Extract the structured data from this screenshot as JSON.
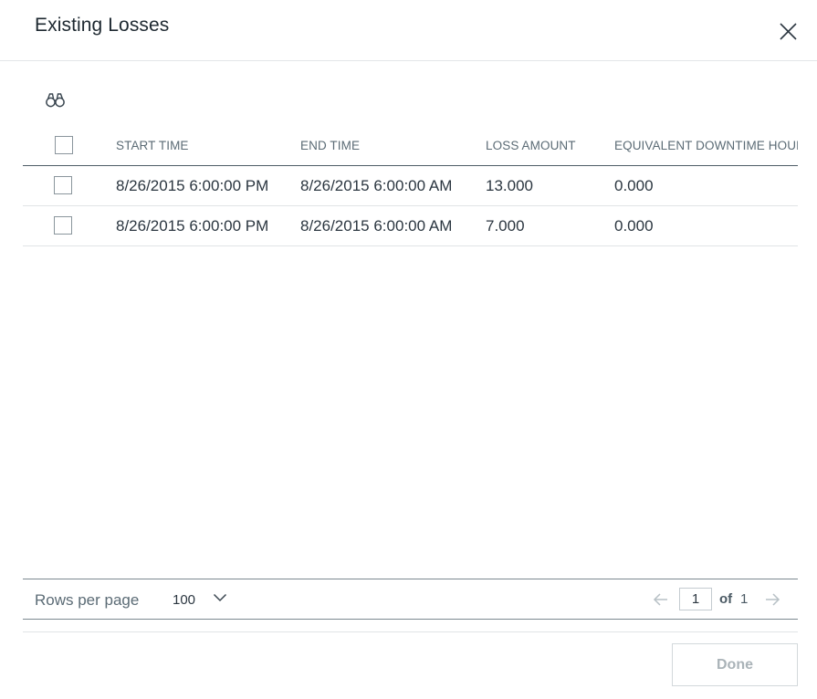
{
  "dialog": {
    "title": "Existing Losses"
  },
  "icons": {
    "close": "close-icon",
    "search": "binoculars-icon",
    "rows_chevron": "chevron-down-icon",
    "prev": "arrow-left-icon",
    "next": "arrow-right-icon"
  },
  "grid": {
    "columns": [
      {
        "label": "START TIME"
      },
      {
        "label": "END TIME"
      },
      {
        "label": "LOSS AMOUNT"
      },
      {
        "label": "EQUIVALENT DOWNTIME HOURS"
      }
    ],
    "rows": [
      {
        "start_time": "8/26/2015 6:00:00 PM",
        "end_time": "8/26/2015 6:00:00 AM",
        "loss_amount": "13.000",
        "downtime_hours": "0.000"
      },
      {
        "start_time": "8/26/2015 6:00:00 PM",
        "end_time": "8/26/2015 6:00:00 AM",
        "loss_amount": "7.000",
        "downtime_hours": "0.000"
      }
    ]
  },
  "pager": {
    "rows_per_page_label": "Rows per page",
    "rows_per_page_value": "100",
    "current_page": "1",
    "of_label": "of",
    "total_pages": "1"
  },
  "footer": {
    "done_label": "Done"
  },
  "colors": {
    "header_rule": "#4d5c66",
    "muted_text": "#5b6b75",
    "disabled_text": "#aab3b8"
  }
}
